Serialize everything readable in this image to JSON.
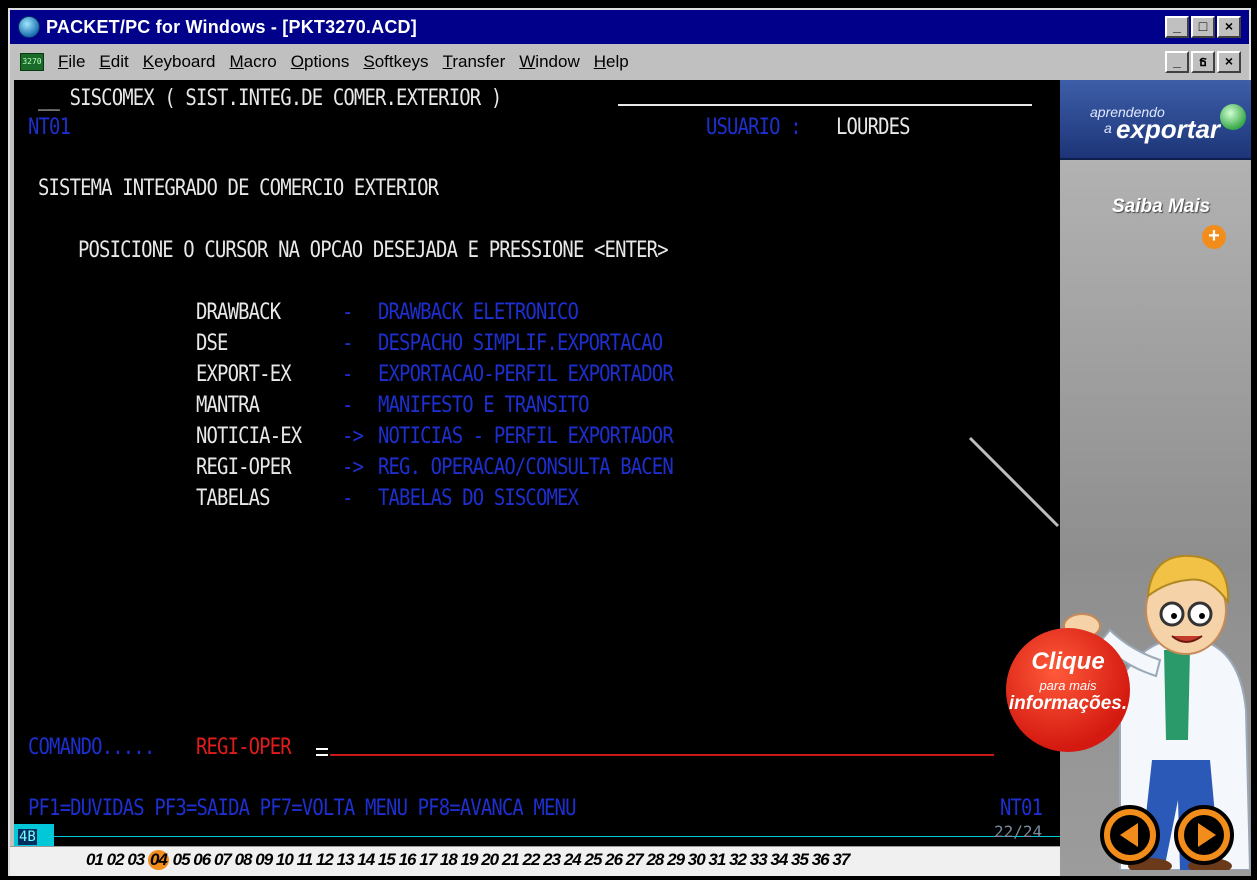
{
  "window": {
    "title": "PACKET/PC for Windows - [PKT3270.ACD]",
    "buttons": [
      "_",
      "□",
      "×"
    ],
    "mdi_buttons": [
      "_",
      "ธ",
      "×"
    ]
  },
  "menubar": {
    "items": [
      "File",
      "Edit",
      "Keyboard",
      "Macro",
      "Options",
      "Softkeys",
      "Transfer",
      "Window",
      "Help"
    ]
  },
  "terminal": {
    "header": "__ SISCOMEX ( SIST.INTEG.DE COMER.EXTERIOR )",
    "session_id": "NT01",
    "user_label": "USUARIO :",
    "user_name": "LOURDES",
    "system_title": "SISTEMA INTEGRADO DE COMERCIO EXTERIOR",
    "instruction": "POSICIONE O CURSOR NA OPCAO DESEJADA E PRESSIONE <ENTER>",
    "options": [
      {
        "code": "DRAWBACK",
        "sep": "-",
        "desc": "DRAWBACK ELETRONICO"
      },
      {
        "code": "DSE",
        "sep": "-",
        "desc": "DESPACHO SIMPLIF.EXPORTACAO"
      },
      {
        "code": "EXPORT-EX",
        "sep": "-",
        "desc": "EXPORTACAO-PERFIL EXPORTADOR"
      },
      {
        "code": "MANTRA",
        "sep": "-",
        "desc": "MANIFESTO E TRANSITO"
      },
      {
        "code": "NOTICIA-EX",
        "sep": "->",
        "desc": "NOTICIAS - PERFIL EXPORTADOR"
      },
      {
        "code": "REGI-OPER",
        "sep": "->",
        "desc": "REG. OPERACAO/CONSULTA BACEN"
      },
      {
        "code": "TABELAS",
        "sep": "-",
        "desc": "TABELAS DO SISCOMEX"
      }
    ],
    "command_label": "COMANDO.....",
    "command_value": "REGI-OPER",
    "function_keys": "PF1=DUVIDAS PF3=SAIDA PF7=VOLTA MENU PF8=AVANCA MENU",
    "footer_id": "NT01",
    "status_indicator": "4B",
    "page_count": "22/24"
  },
  "pagebar": {
    "pages": [
      "01",
      "02",
      "03",
      "04",
      "05",
      "06",
      "07",
      "08",
      "09",
      "10",
      "11",
      "12",
      "13",
      "14",
      "15",
      "16",
      "17",
      "18",
      "19",
      "20",
      "21",
      "22",
      "23",
      "24",
      "25",
      "26",
      "27",
      "28",
      "29",
      "30",
      "31",
      "32",
      "33",
      "34",
      "35",
      "36",
      "37"
    ],
    "active_page": "04"
  },
  "promo": {
    "logo_small": "aprendendo",
    "logo_a": "a",
    "logo_big": "exportar",
    "saiba_mais": "Saiba Mais",
    "clique_line1": "Clique",
    "clique_line2": "para mais",
    "clique_line3": "informações."
  },
  "colors": {
    "title_bar": "#00008b",
    "terminal_bg": "#000000",
    "terminal_text": "#e8e8e8",
    "terminal_blue": "#1e2fd0",
    "terminal_red": "#e21b1b",
    "accent_orange": "#f28c1a"
  },
  "icons": {
    "app": "globe-app-icon",
    "menu": "terminal-3270-icon",
    "prev": "arrow-left-icon",
    "next": "arrow-right-icon",
    "saiba_plus": "plus-icon"
  }
}
